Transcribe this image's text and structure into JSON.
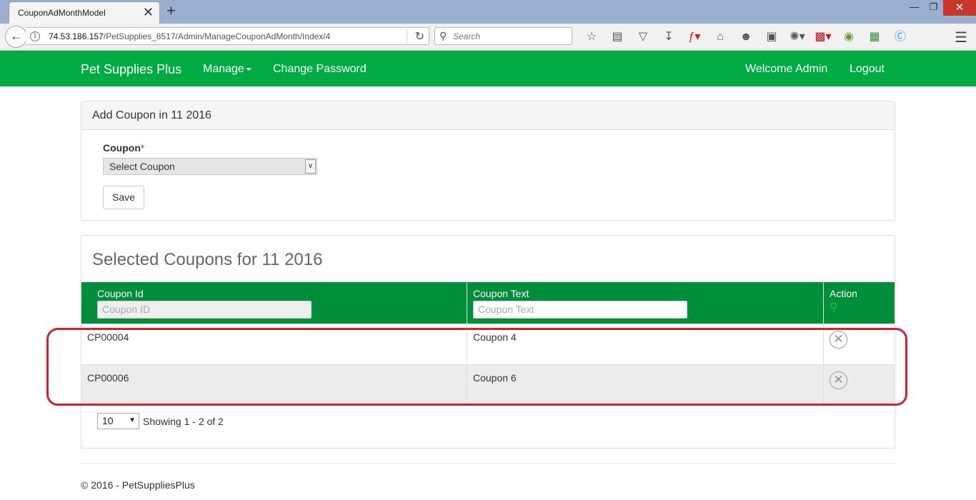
{
  "browser": {
    "tab_title": "CouponAdMonthModel",
    "tab_close": "✕",
    "new_tab": "+",
    "url_host": "74.53.186.157",
    "url_path": "/PetSupplies_8517/Admin/ManageCouponAdMonth/Index/4",
    "search_placeholder": "Search",
    "window_controls": [
      "—",
      "❐",
      "✕"
    ]
  },
  "nav": {
    "brand": "Pet Supplies Plus",
    "manage": "Manage",
    "change_password": "Change Password",
    "welcome": "Welcome Admin",
    "logout": "Logout"
  },
  "add_panel": {
    "heading": "Add Coupon in 11 2016",
    "coupon_label": "Coupon",
    "required_mark": "*",
    "select_value": "Select Coupon",
    "save_label": "Save"
  },
  "selected_panel": {
    "heading": "Selected Coupons for 11 2016",
    "columns": [
      "Coupon Id",
      "Coupon Text",
      "Action"
    ],
    "filters": {
      "coupon_id_placeholder": "Coupon ID",
      "coupon_text_placeholder": "Coupon Text"
    },
    "rows": [
      {
        "id": "CP00004",
        "text": "Coupon 4"
      },
      {
        "id": "CP00006",
        "text": "Coupon 6"
      }
    ],
    "page_size": "10",
    "paging_text": "Showing 1 - 2 of 2"
  },
  "footer": {
    "text": "© 2016 - PetSuppliesPlus"
  },
  "colors": {
    "nav_green": "#00ab44",
    "header_green": "#008e3a",
    "highlight_red": "#d0232f"
  },
  "icons": [
    "back-arrow-icon",
    "info-icon",
    "reload-icon",
    "search-icon",
    "star-icon",
    "reading-list-icon",
    "pocket-icon",
    "download-icon",
    "flash-icon",
    "home-icon",
    "face-icon",
    "screenshot-icon",
    "bug-icon",
    "news-icon",
    "addon-icon",
    "skype-icon",
    "hamburger-menu-icon",
    "remove-circle-icon",
    "green-search-icon"
  ]
}
